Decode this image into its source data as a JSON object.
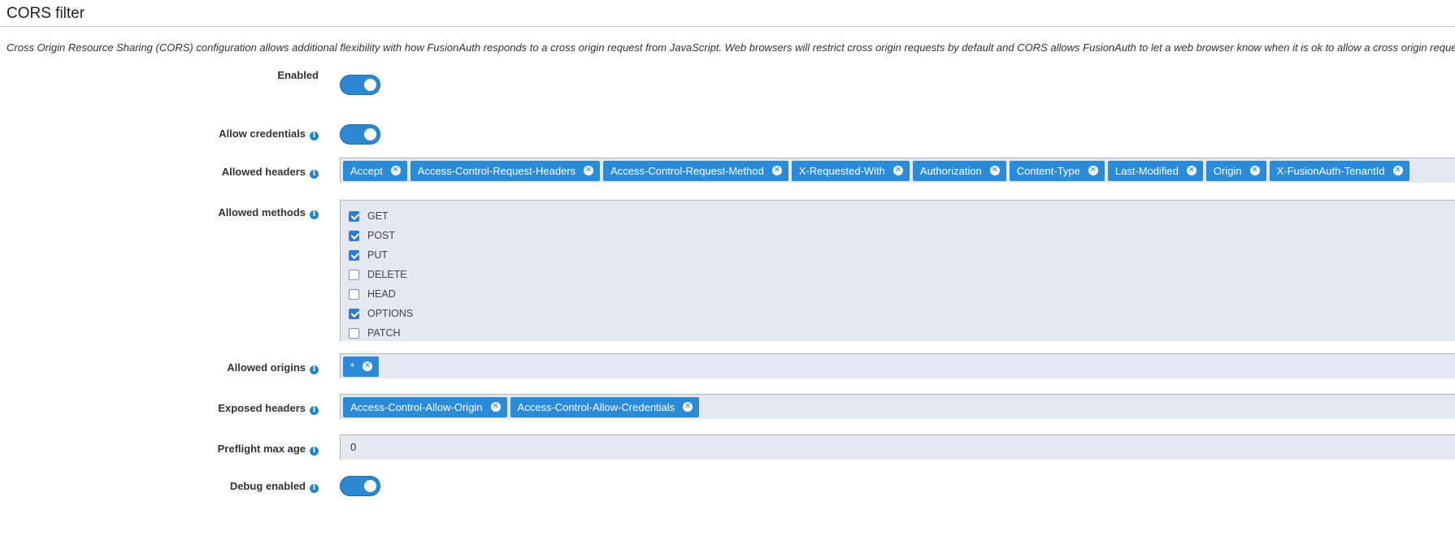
{
  "section": {
    "title": "CORS filter",
    "description": "Cross Origin Resource Sharing (CORS) configuration allows additional flexibility with how FusionAuth responds to a cross origin request from JavaScript. Web browsers will restrict cross origin requests by default and CORS allows FusionAuth to let a web browser know when it is ok to allow a cross origin request."
  },
  "fields": {
    "enabled": {
      "label": "Enabled",
      "value": true
    },
    "allow_credentials": {
      "label": "Allow credentials",
      "value": true
    },
    "allowed_headers": {
      "label": "Allowed headers",
      "values": [
        "Accept",
        "Access-Control-Request-Headers",
        "Access-Control-Request-Method",
        "X-Requested-With",
        "Authorization",
        "Content-Type",
        "Last-Modified",
        "Origin",
        "X-FusionAuth-TenantId"
      ]
    },
    "allowed_methods": {
      "label": "Allowed methods",
      "options": [
        {
          "name": "GET",
          "checked": true
        },
        {
          "name": "POST",
          "checked": true
        },
        {
          "name": "PUT",
          "checked": true
        },
        {
          "name": "DELETE",
          "checked": false
        },
        {
          "name": "HEAD",
          "checked": false
        },
        {
          "name": "OPTIONS",
          "checked": true
        },
        {
          "name": "PATCH",
          "checked": false
        }
      ]
    },
    "allowed_origins": {
      "label": "Allowed origins",
      "values": [
        "*"
      ]
    },
    "exposed_headers": {
      "label": "Exposed headers",
      "values": [
        "Access-Control-Allow-Origin",
        "Access-Control-Allow-Credentials"
      ]
    },
    "preflight_max_age": {
      "label": "Preflight max age",
      "value": "0"
    },
    "debug_enabled": {
      "label": "Debug enabled",
      "value": true
    }
  },
  "icons": {
    "info": "info-circle-icon",
    "remove": "times-circle-icon"
  },
  "colors": {
    "accent": "#2b8bd8",
    "field_bg": "#e4e9f1",
    "info": "#1c86d1"
  }
}
